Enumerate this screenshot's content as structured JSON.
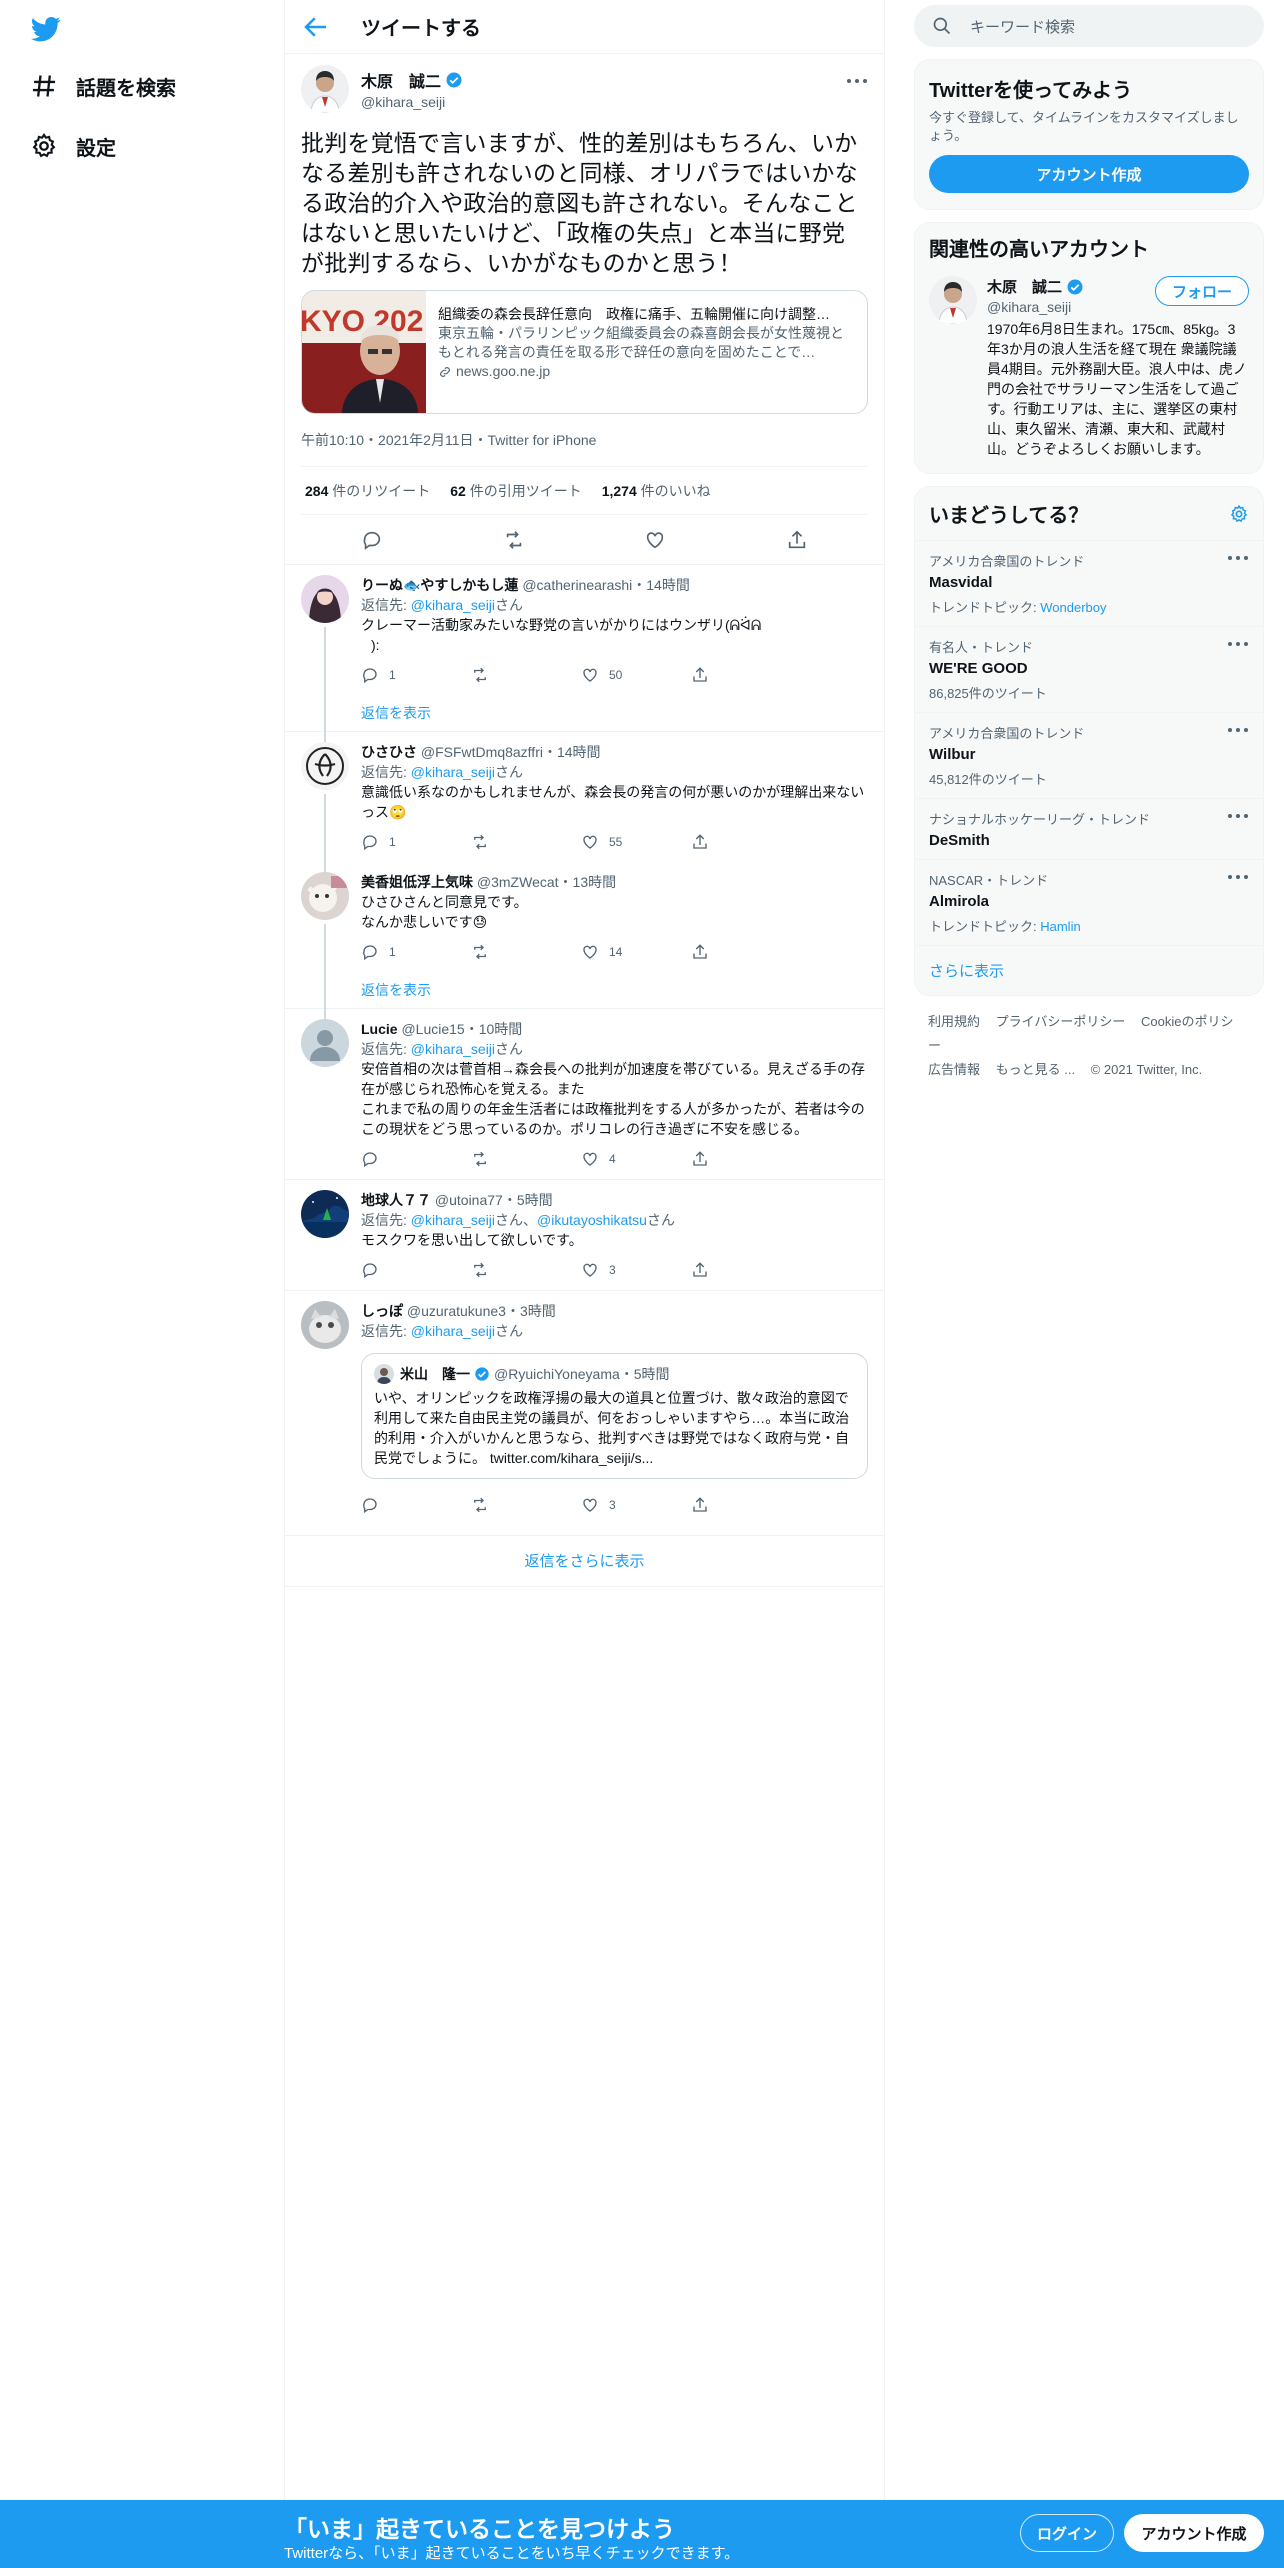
{
  "nav": {
    "explore_label": "話題を検索",
    "settings_label": "設定"
  },
  "header": {
    "title": "ツイートする"
  },
  "tweet": {
    "name": "木原　誠二",
    "handle": "@kihara_seiji",
    "text": "批判を覚悟で言いますが、性的差別はもちろん、いかなる差別も許されないのと同様、オリパラではいかなる政治的介入や政治的意図も許されない。そんなことはないと思いたいけど、「政権の失点」と本当に野党が批判するなら、いかがなものかと思う！",
    "card": {
      "image_text": "KYO 202",
      "title": "組織委の森会長辞任意向　政権に痛手、五輪開催に向け調整…",
      "description": "東京五輪・パラリンピック組織委員会の森喜朗会長が女性蔑視ともとれる発言の責任を取る形で辞任の意向を固めたことで…",
      "domain": "news.goo.ne.jp"
    },
    "meta": "午前10:10・2021年2月11日・Twitter for iPhone",
    "stats": {
      "retweets": "284",
      "retweets_label": "件のリツイート",
      "quotes": "62",
      "quotes_label": "件の引用ツイート",
      "likes": "1,274",
      "likes_label": "件のいいね"
    }
  },
  "replies": [
    {
      "name": "りーぬ🐟やすしかもし蓮",
      "handle": "@catherinearashi",
      "time": "・14時間",
      "reply_to_prefix": "返信先: ",
      "reply_to": "@kihara_seiji",
      "reply_to_suffix": "さん",
      "text": "クレーマー活動家みたいな野党の言いがかりにはウンザリ(ᕱᐛᕱ",
      "text2": "):",
      "replies": "1",
      "likes": "50",
      "show_replies": "返信を表示"
    },
    {
      "name": "ひさひさ",
      "handle": "@FSFwtDmq8azffri",
      "time": "・14時間",
      "reply_to_prefix": "返信先: ",
      "reply_to": "@kihara_seiji",
      "reply_to_suffix": "さん",
      "text": "意識低い系なのかもしれませんが、森会長の発言の何が悪いのかが理解出来ないっス🙄",
      "replies": "1",
      "likes": "55"
    },
    {
      "name": "美香姐低浮上気味",
      "handle": "@3mZWecat",
      "time": "・13時間",
      "text": "ひさひさんと同意見です。",
      "text2": "なんか悲しいです😓",
      "replies": "1",
      "likes": "14",
      "show_replies": "返信を表示"
    },
    {
      "name": "Lucie",
      "handle": "@Lucie15",
      "time": "・10時間",
      "reply_to_prefix": "返信先: ",
      "reply_to": "@kihara_seiji",
      "reply_to_suffix": "さん",
      "text": "安倍首相の次は菅首相→森会長への批判が加速度を帯びている。見えざる手の存在が感じられ恐怖心を覚える。また",
      "text2": "これまで私の周りの年金生活者には政権批判をする人が多かったが、若者は今のこの現状をどう思っているのか。ポリコレの行き過ぎに不安を感じる。",
      "likes": "4"
    },
    {
      "name": "地球人７７",
      "handle": "@utoina77",
      "time": "・5時間",
      "reply_to_prefix": "返信先: ",
      "reply_to": "@kihara_seiji",
      "reply_to_mid": "さん、",
      "reply_to2": "@ikutayoshikatsu",
      "reply_to_suffix": "さん",
      "text": "モスクワを思い出して欲しいです。",
      "likes": "3"
    },
    {
      "name": "しっぽ",
      "handle": "@uzuratukune3",
      "time": "・3時間",
      "reply_to_prefix": "返信先: ",
      "reply_to": "@kihara_seiji",
      "reply_to_suffix": "さん",
      "quote": {
        "name": "米山　隆一",
        "handle": "@RyuichiYoneyama",
        "time": "・5時間",
        "text": "いや、オリンピックを政権浮揚の最大の道具と位置づけ、散々政治的意図で利用して来た自由民主党の議員が、何をおっしゃいますやら…。本当に政治的利用・介入がいかんと思うなら、批判すべきは野党ではなく政府与党・自民党でしょうに。 twitter.com/kihara_seiji/s..."
      },
      "likes": "3"
    }
  ],
  "more_replies": "返信をさらに表示",
  "right": {
    "search_placeholder": "キーワード検索",
    "join": {
      "title": "Twitterを使ってみよう",
      "text": "今すぐ登録して、タイムラインをカスタマイズしましょう。",
      "button": "アカウント作成"
    },
    "related": {
      "title": "関連性の高いアカウント",
      "name": "木原　誠二",
      "handle": "@kihara_seiji",
      "follow": "フォロー",
      "bio": "1970年6月8日生まれ。175㎝、85kg。3年3か月の浪人生活を経て現在 衆議院議員4期目。元外務副大臣。浪人中は、虎ノ門の会社でサラリーマン生活をして過ごす。行動エリアは、主に、選挙区の東村山、東久留米、清瀬、東大和、武蔵村山。どうぞよろしくお願いします。"
    },
    "trends": {
      "title": "いまどうしてる？",
      "items": [
        {
          "context": "アメリカ合衆国のトレンド",
          "name": "Masvidal",
          "sub_prefix": "トレンドトピック: ",
          "sub_link": "Wonderboy"
        },
        {
          "context": "有名人・トレンド",
          "name": "WE'RE GOOD",
          "sub": "86,825件のツイート"
        },
        {
          "context": "アメリカ合衆国のトレンド",
          "name": "Wilbur",
          "sub": "45,812件のツイート"
        },
        {
          "context": "ナショナルホッケーリーグ・トレンド",
          "name": "DeSmith"
        },
        {
          "context": "NASCAR・トレンド",
          "name": "Almirola",
          "sub_prefix": "トレンドトピック: ",
          "sub_link": "Hamlin"
        }
      ],
      "show_more": "さらに表示"
    },
    "footer": {
      "terms": "利用規約",
      "privacy": "プライバシーポリシー",
      "cookie": "Cookieのポリシー",
      "ads": "広告情報",
      "more": "もっと見る ...",
      "copyright": "© 2021 Twitter, Inc."
    }
  },
  "bottom": {
    "title": "「いま」起きていることを見つけよう",
    "subtitle": "Twitterなら、「いま」起きていることをいち早くチェックできます。",
    "login": "ログイン",
    "signup": "アカウント作成"
  },
  "colors": {
    "accent": "#1d9bf0",
    "text": "#0f1419",
    "secondary": "#536471"
  }
}
